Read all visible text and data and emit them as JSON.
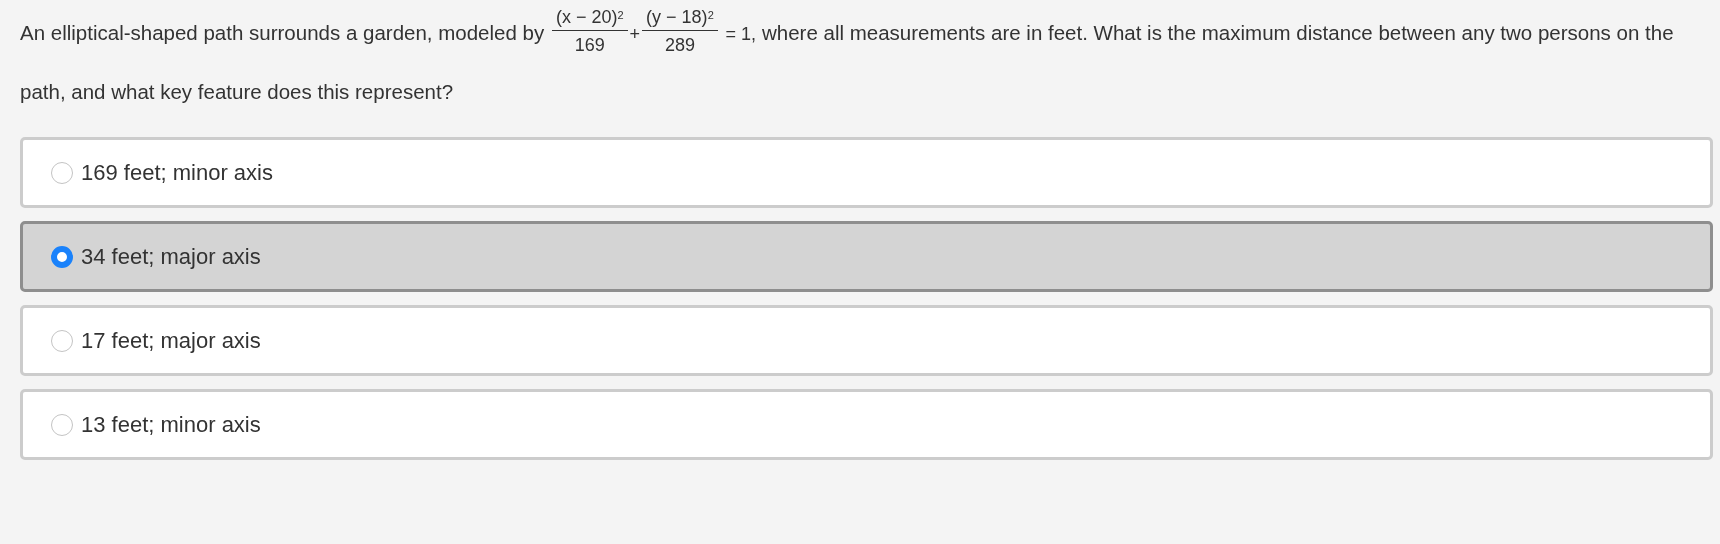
{
  "question": {
    "before": "An elliptical-shaped path surrounds a garden, modeled by",
    "formula": {
      "terms": [
        {
          "numerator": "(x − 20)$^{2}$",
          "denominator": "169"
        },
        {
          "numerator": "(y − 18)$^{2}$",
          "denominator": "289"
        }
      ],
      "operator": "+",
      "equals": "= 1,"
    },
    "after": "where all measurements are in feet. What is the maximum distance between any two persons on the path, and what key feature does this represent?"
  },
  "options": [
    {
      "label": "169 feet; minor axis",
      "selected": false
    },
    {
      "label": "34 feet; major axis",
      "selected": true
    },
    {
      "label": "17 feet; major axis",
      "selected": false
    },
    {
      "label": "13 feet; minor axis",
      "selected": false
    }
  ]
}
